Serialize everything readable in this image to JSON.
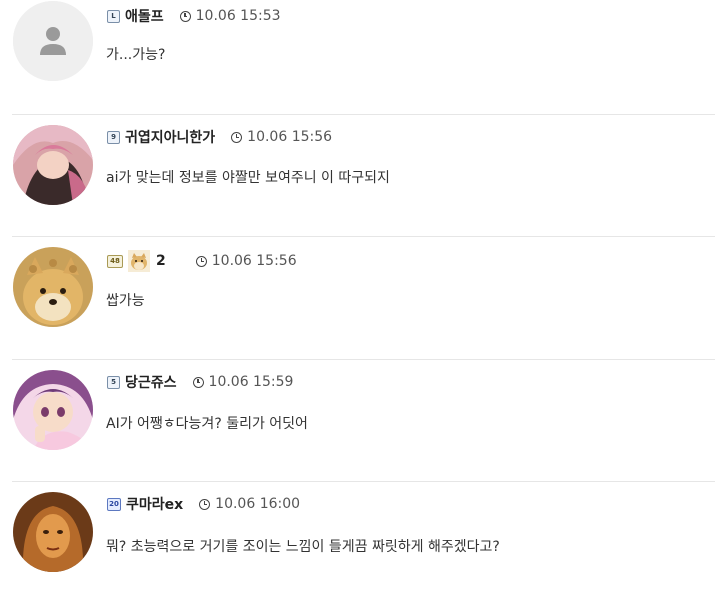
{
  "comments": [
    {
      "level": "L",
      "nickname": "애돌프",
      "time": "10.06 15:53",
      "text": "가...가능?",
      "avatar": "default-user-avatar"
    },
    {
      "level": "9",
      "nickname": "귀엽지아니한가",
      "time": "10.06 15:56",
      "text": "ai가 맞는데 정보를 야짤만 보여주니 이 따구되지",
      "avatar": "anime-girl-pink-hair-avatar"
    },
    {
      "level": "48",
      "nickname": "2",
      "time": "10.06 15:56",
      "text": "쌉가능",
      "avatar": "doge-avatar",
      "nickname_icon": "doge-icon"
    },
    {
      "level": "5",
      "nickname": "당근쥬스",
      "time": "10.06 15:59",
      "text": "AI가 어쨍ㅎ다능겨? 둘리가 어딧어",
      "avatar": "anime-girl-purple-hair-avatar"
    },
    {
      "level": "20",
      "nickname": "쿠마라ex",
      "time": "10.06 16:00",
      "text": "뭐? 초능력으로 거기를 조이는 느낌이 들게끔 짜릿하게 해주겠다고?",
      "avatar": "woman-gold-avatar"
    }
  ]
}
